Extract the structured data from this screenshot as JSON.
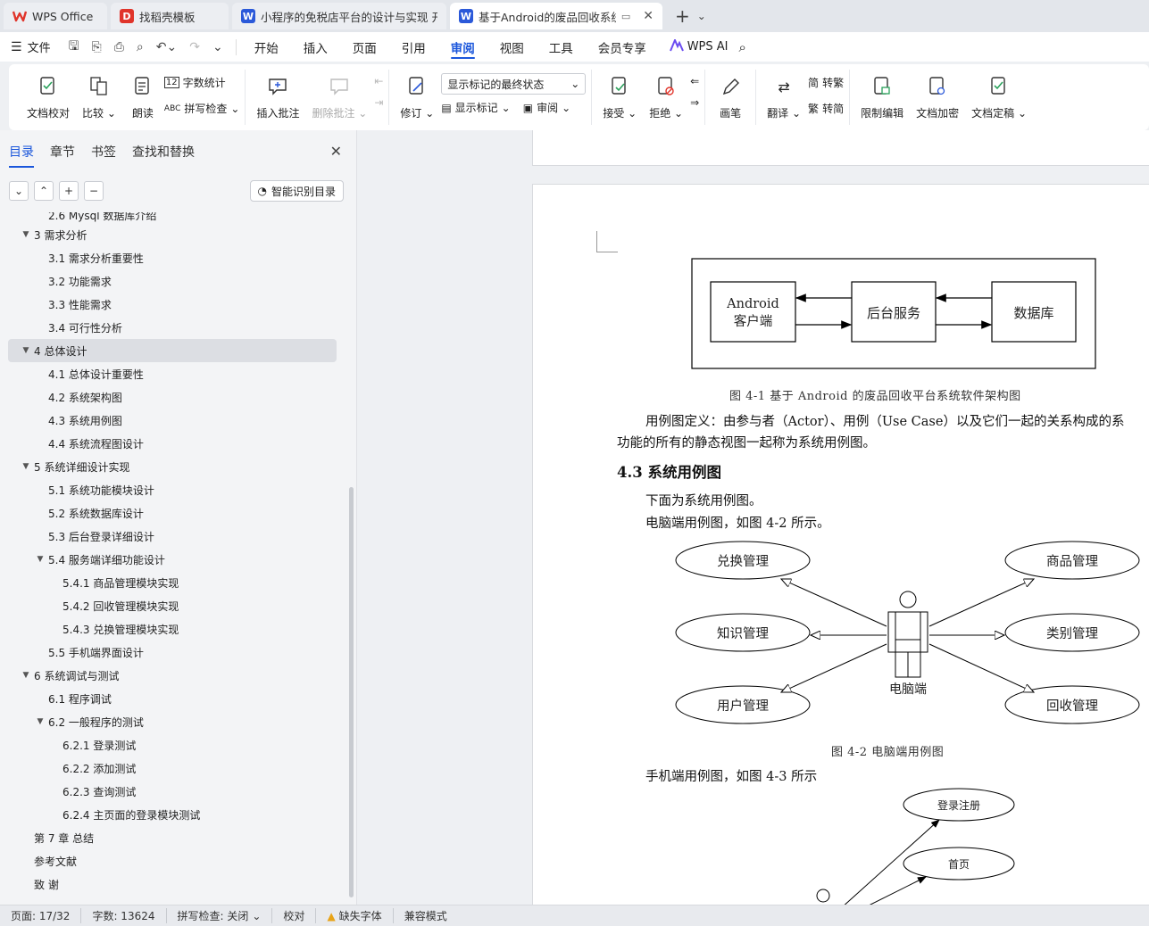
{
  "tabs": [
    {
      "label": "WPS Office",
      "icon": "wps-logo-icon",
      "color": "#e0342a"
    },
    {
      "label": "找稻壳模板",
      "icon": "docer-icon",
      "color": "#e0342a"
    },
    {
      "label": "小程序的免税店平台的设计与实现 开",
      "icon": "word-doc-icon",
      "color": "#2b59d9"
    },
    {
      "label": "基于Android的废品回收系统",
      "icon": "word-doc-icon",
      "color": "#2b59d9"
    }
  ],
  "menubar": {
    "file_label": "文件",
    "items": [
      "开始",
      "插入",
      "页面",
      "引用",
      "审阅",
      "视图",
      "工具",
      "会员专享"
    ],
    "active": "审阅",
    "ai_label": "WPS AI"
  },
  "ribbon": {
    "proofread": "文档校对",
    "compare": "比较",
    "read_aloud": "朗读",
    "word_count": "字数统计",
    "spell_check": "拼写检查",
    "insert_comment": "插入批注",
    "delete_comment": "删除批注",
    "revise": "修订",
    "markup_select": "显示标记的最终状态",
    "show_markup": "显示标记",
    "review_pane": "审阅",
    "accept": "接受",
    "reject": "拒绝",
    "pen": "画笔",
    "translate": "翻译",
    "to_traditional": "转繁",
    "to_simplified": "转简",
    "restrict_edit": "限制编辑",
    "encrypt": "文档加密",
    "finalize": "文档定稿"
  },
  "nav": {
    "tabs": [
      "目录",
      "章节",
      "书签",
      "查找和替换"
    ],
    "active_tab": "目录",
    "smart_btn": "智能识别目录",
    "toc": [
      {
        "label": "2.6 Mysql 数据库介绍",
        "level": 2,
        "tri": ""
      },
      {
        "label": "3  需求分析",
        "level": 1,
        "tri": "▼"
      },
      {
        "label": "3.1  需求分析重要性",
        "level": 2,
        "tri": ""
      },
      {
        "label": "3.2  功能需求",
        "level": 2,
        "tri": ""
      },
      {
        "label": "3.3  性能需求",
        "level": 2,
        "tri": ""
      },
      {
        "label": "3.4  可行性分析",
        "level": 2,
        "tri": ""
      },
      {
        "label": "4  总体设计",
        "level": 1,
        "tri": "▼",
        "selected": true
      },
      {
        "label": "4.1  总体设计重要性",
        "level": 2,
        "tri": ""
      },
      {
        "label": "4.2  系统架构图",
        "level": 2,
        "tri": ""
      },
      {
        "label": "4.3  系统用例图",
        "level": 2,
        "tri": ""
      },
      {
        "label": "4.4  系统流程图设计",
        "level": 2,
        "tri": ""
      },
      {
        "label": "5  系统详细设计实现",
        "level": 1,
        "tri": "▼"
      },
      {
        "label": "5.1  系统功能模块设计",
        "level": 2,
        "tri": ""
      },
      {
        "label": "5.2  系统数据库设计",
        "level": 2,
        "tri": ""
      },
      {
        "label": "5.3  后台登录详细设计",
        "level": 2,
        "tri": ""
      },
      {
        "label": "5.4  服务端详细功能设计",
        "level": 2,
        "tri": "▼"
      },
      {
        "label": "5.4.1  商品管理模块实现",
        "level": 3,
        "tri": ""
      },
      {
        "label": "5.4.2  回收管理模块实现",
        "level": 3,
        "tri": ""
      },
      {
        "label": "5.4.3  兑换管理模块实现",
        "level": 3,
        "tri": ""
      },
      {
        "label": "5.5  手机端界面设计",
        "level": 2,
        "tri": ""
      },
      {
        "label": "6  系统调试与测试",
        "level": 1,
        "tri": "▼"
      },
      {
        "label": "6.1  程序调试",
        "level": 2,
        "tri": ""
      },
      {
        "label": "6.2  一般程序的测试",
        "level": 2,
        "tri": "▼"
      },
      {
        "label": "6.2.1  登录测试",
        "level": 3,
        "tri": ""
      },
      {
        "label": "6.2.2  添加测试",
        "level": 3,
        "tri": ""
      },
      {
        "label": "6.2.3  查询测试",
        "level": 3,
        "tri": ""
      },
      {
        "label": "6.2.4  主页面的登录模块测试",
        "level": 3,
        "tri": ""
      },
      {
        "label": "第 7 章  总结",
        "level": 1,
        "tri": ""
      },
      {
        "label": "参考文献",
        "level": 1,
        "tri": ""
      },
      {
        "label": "致  谢",
        "level": 1,
        "tri": ""
      }
    ]
  },
  "doc": {
    "arch": {
      "client_line1": "Android",
      "client_line2": "客户端",
      "server": "后台服务",
      "db": "数据库"
    },
    "caption1": "图 4-1   基于 Android 的废品回收平台系统软件架构图",
    "para1_line1": "用例图定义：由参与者（Actor）、用例（Use Case）以及它们一起的关系构成的系",
    "para1_line2": "功能的所有的静态视图一起称为系统用例图。",
    "heading": "4.3  系统用例图",
    "para2": "下面为系统用例图。",
    "para3": "电脑端用例图，如图 4-2 所示。",
    "usecase": {
      "left": [
        "兑换管理",
        "知识管理",
        "用户管理"
      ],
      "right": [
        "商品管理",
        "类别管理",
        "回收管理"
      ],
      "actor": "电脑端"
    },
    "caption2": "图 4-2  电脑端用例图",
    "para4": "手机端用例图，如图 4-3 所示",
    "mobile": [
      "登录注册",
      "首页"
    ]
  },
  "status": {
    "page": "页面: 17/32",
    "words": "字数: 13624",
    "spell": "拼写检查: 关闭",
    "proof": "校对",
    "font_warn": "缺失字体",
    "compat": "兼容模式"
  }
}
